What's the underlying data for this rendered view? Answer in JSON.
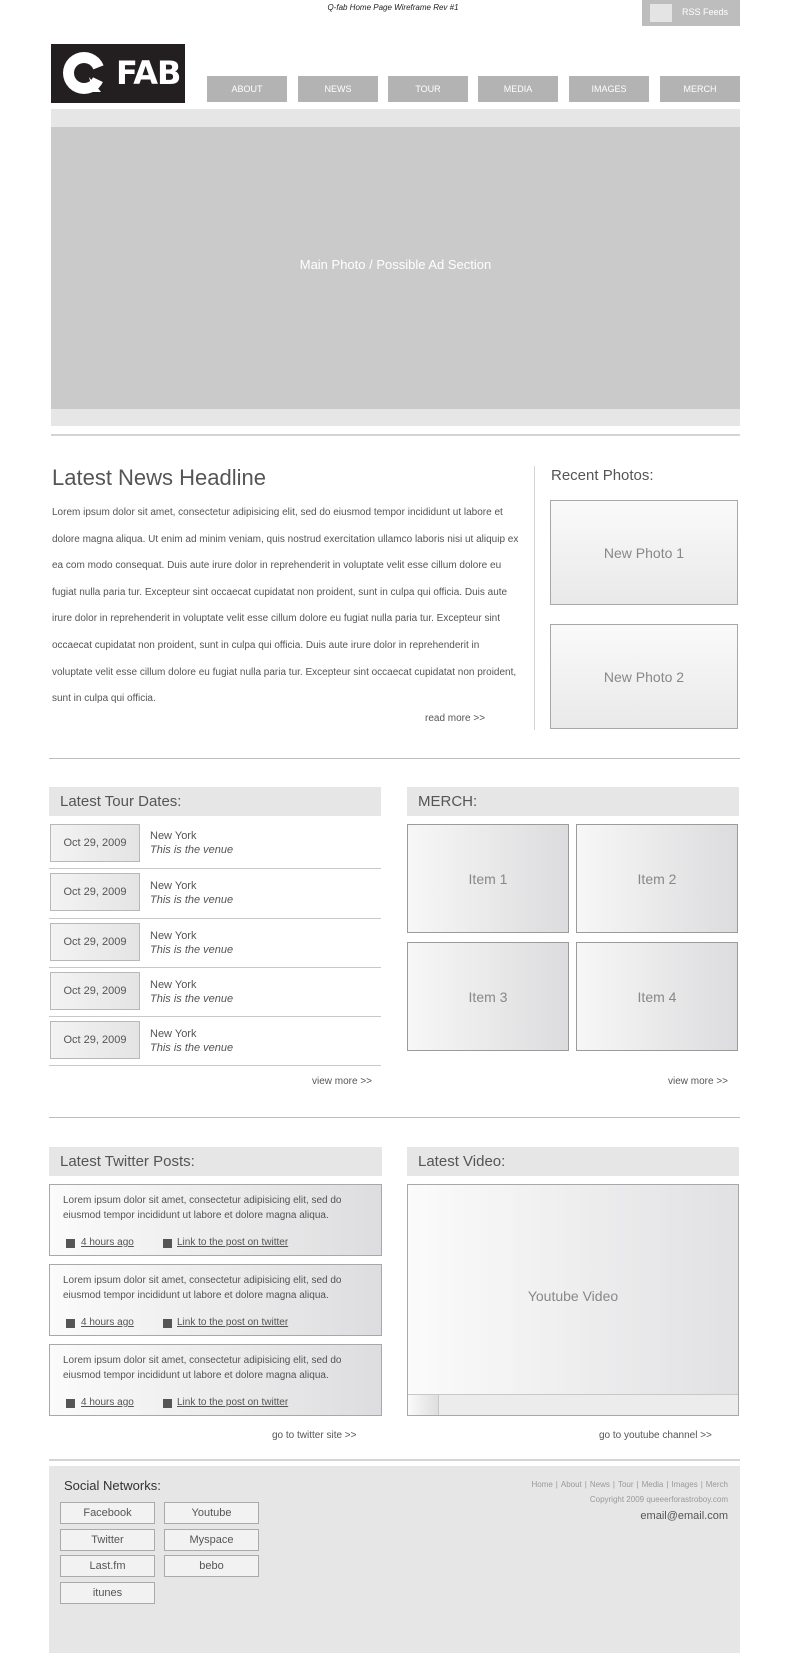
{
  "page": {
    "wireframe_title": "Q-fab Home Page Wireframe Rev #1",
    "rss_label": "RSS Feeds"
  },
  "logo": {
    "text": "FAB"
  },
  "nav": [
    "ABOUT",
    "NEWS",
    "TOUR",
    "MEDIA",
    "IMAGES",
    "MERCH"
  ],
  "hero": {
    "label": "Main Photo / Possible Ad Section"
  },
  "news": {
    "headline": "Latest News Headline",
    "body": "Lorem ipsum dolor sit amet, consectetur adipisicing elit, sed do eiusmod tempor incididunt ut labore et dolore magna aliqua. Ut enim ad minim veniam, quis nostrud exercitation ullamco laboris nisi ut aliquip ex ea com modo consequat. Duis aute irure dolor in reprehenderit in voluptate velit esse cillum dolore eu fugiat nulla paria tur. Excepteur sint occaecat cupidatat non proident, sunt in culpa qui officia. Duis aute irure dolor in reprehenderit in voluptate velit esse cillum dolore eu fugiat nulla paria tur. Excepteur sint occaecat cupidatat non proident, sunt in culpa qui officia. Duis aute irure dolor in reprehenderit in voluptate velit esse cillum dolore eu fugiat nulla paria tur. Excepteur sint occaecat cupidatat non proident, sunt in culpa qui officia.",
    "read_more": "read more  >>"
  },
  "recent_photos": {
    "title": "Recent Photos:",
    "items": [
      "New Photo 1",
      "New Photo 2"
    ]
  },
  "tour": {
    "title": "Latest Tour Dates:",
    "items": [
      {
        "date": "Oct 29, 2009",
        "city": "New York",
        "venue": "This is the venue"
      },
      {
        "date": "Oct 29, 2009",
        "city": "New York",
        "venue": "This is the venue"
      },
      {
        "date": "Oct 29, 2009",
        "city": "New York",
        "venue": "This is the venue"
      },
      {
        "date": "Oct 29, 2009",
        "city": "New York",
        "venue": "This is the venue"
      },
      {
        "date": "Oct 29, 2009",
        "city": "New York",
        "venue": "This is the venue"
      }
    ],
    "view_more": "view more  >>"
  },
  "merch": {
    "title": "MERCH:",
    "items": [
      "Item 1",
      "Item 2",
      "Item 3",
      "Item 4"
    ],
    "view_more": "view more  >>"
  },
  "twitter": {
    "title": "Latest Twitter Posts:",
    "posts": [
      {
        "text": "Lorem ipsum dolor sit amet, consectetur adipisicing elit, sed do eiusmod tempor incididunt ut labore et dolore magna aliqua.",
        "time": "4 hours ago",
        "link": "Link to the post on twitter"
      },
      {
        "text": "Lorem ipsum dolor sit amet, consectetur adipisicing elit, sed do eiusmod tempor incididunt ut labore et dolore magna aliqua.",
        "time": "4 hours ago",
        "link": "Link to the post on twitter"
      },
      {
        "text": "Lorem ipsum dolor sit amet, consectetur adipisicing elit, sed do eiusmod tempor incididunt ut labore et dolore magna aliqua.",
        "time": "4 hours ago",
        "link": "Link to the post on twitter"
      }
    ],
    "go_to": "go to twitter site  >>"
  },
  "video": {
    "title": "Latest Video:",
    "label": "Youtube Video",
    "go_to": "go to youtube channel  >>"
  },
  "footer": {
    "social_title": "Social Networks:",
    "social": [
      "Facebook",
      "Youtube",
      "Twitter",
      "Myspace",
      "Last.fm",
      "bebo",
      "itunes"
    ],
    "nav": [
      "Home",
      "About",
      "News",
      "Tour",
      "Media",
      "Images",
      "Merch"
    ],
    "copyright": "Copyright 2009 queeerforastroboy.com",
    "email": "email@email.com"
  }
}
